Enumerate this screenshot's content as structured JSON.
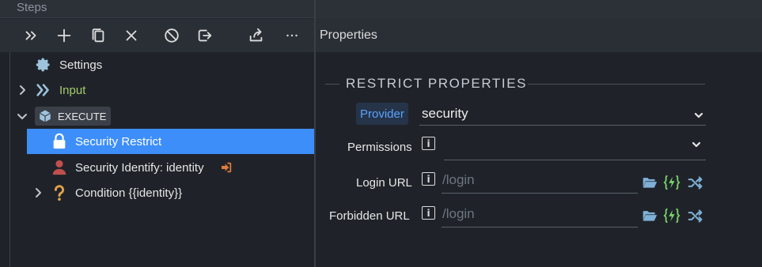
{
  "steps": {
    "title": "Steps",
    "toolbar": [
      {
        "name": "expand-icon"
      },
      {
        "name": "add-icon"
      },
      {
        "name": "copy-icon"
      },
      {
        "name": "delete-icon"
      },
      {
        "name": "disable-icon"
      },
      {
        "name": "move-out-icon"
      },
      {
        "name": "share-icon"
      },
      {
        "name": "more-icon"
      }
    ],
    "tree": {
      "settings": "Settings",
      "input": "Input",
      "execute": "EXECUTE",
      "security_restrict": "Security Restrict",
      "security_identify": "Security Identify: identity",
      "condition": "Condition {{identity}}"
    }
  },
  "properties": {
    "title": "Properties",
    "section": "RESTRICT PROPERTIES",
    "provider": {
      "label": "Provider",
      "value": "security"
    },
    "permissions": {
      "label": "Permissions",
      "value": ""
    },
    "login_url": {
      "label": "Login URL",
      "placeholder": "/login"
    },
    "forbidden_url": {
      "label": "Forbidden URL",
      "placeholder": "/login"
    }
  },
  "colors": {
    "selected": "#3d8ef8",
    "provider_text": "#5aa2ff",
    "input_green": "#a3cc6a",
    "execute_icon": "#9ec3dd",
    "person": "#c0504d",
    "question": "#e4a24a",
    "folder": "#7fb0d6",
    "lightning": "#7bd36a"
  }
}
